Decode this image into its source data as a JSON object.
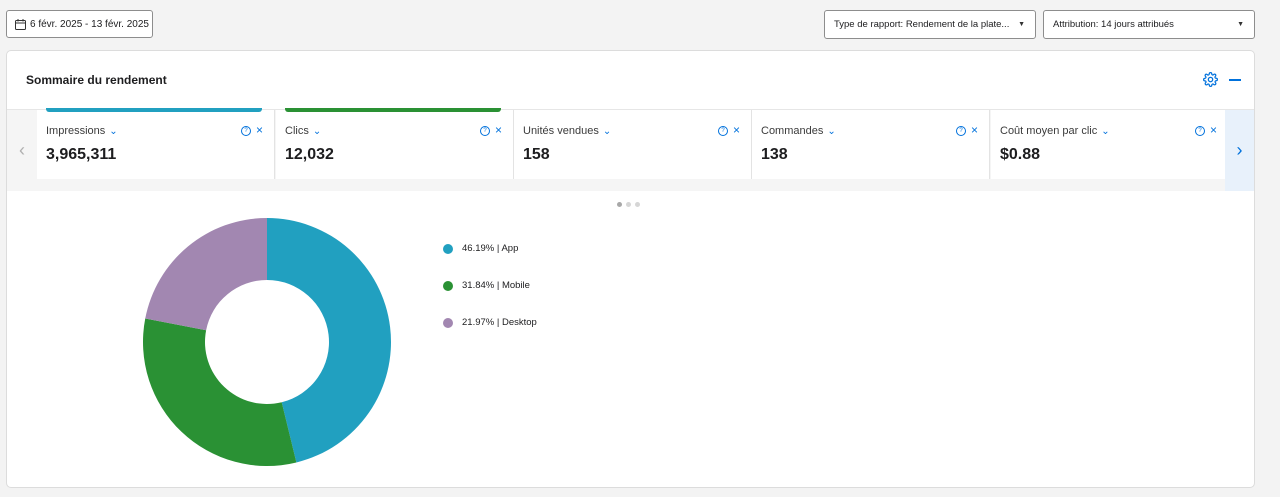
{
  "toolbar": {
    "date_range": "6 févr. 2025 - 13 févr. 2025",
    "report_type": "Type de rapport: Rendement de la plate...",
    "attribution": "Attribution: 14 jours attribués"
  },
  "summary": {
    "title": "Sommaire du rendement",
    "metrics": [
      {
        "label": "Impressions",
        "value": "3,965,311",
        "color": "#21a0c0"
      },
      {
        "label": "Clics",
        "value": "12,032",
        "color": "#2a9134"
      },
      {
        "label": "Unités vendues",
        "value": "158",
        "color": ""
      },
      {
        "label": "Commandes",
        "value": "138",
        "color": ""
      },
      {
        "label": "Coût moyen par clic",
        "value": "$0.88",
        "color": ""
      }
    ],
    "carousel_pages": 3,
    "carousel_active": 0
  },
  "chart_data": {
    "type": "pie",
    "donut": true,
    "categories": [
      "App",
      "Mobile",
      "Desktop"
    ],
    "values": [
      46.19,
      31.84,
      21.97
    ],
    "legend": [
      "46.19% | App",
      "31.84% | Mobile",
      "21.97% | Desktop"
    ],
    "colors": [
      "#21a0c0",
      "#2a9134",
      "#a287b1"
    ],
    "legend_position": "right"
  }
}
